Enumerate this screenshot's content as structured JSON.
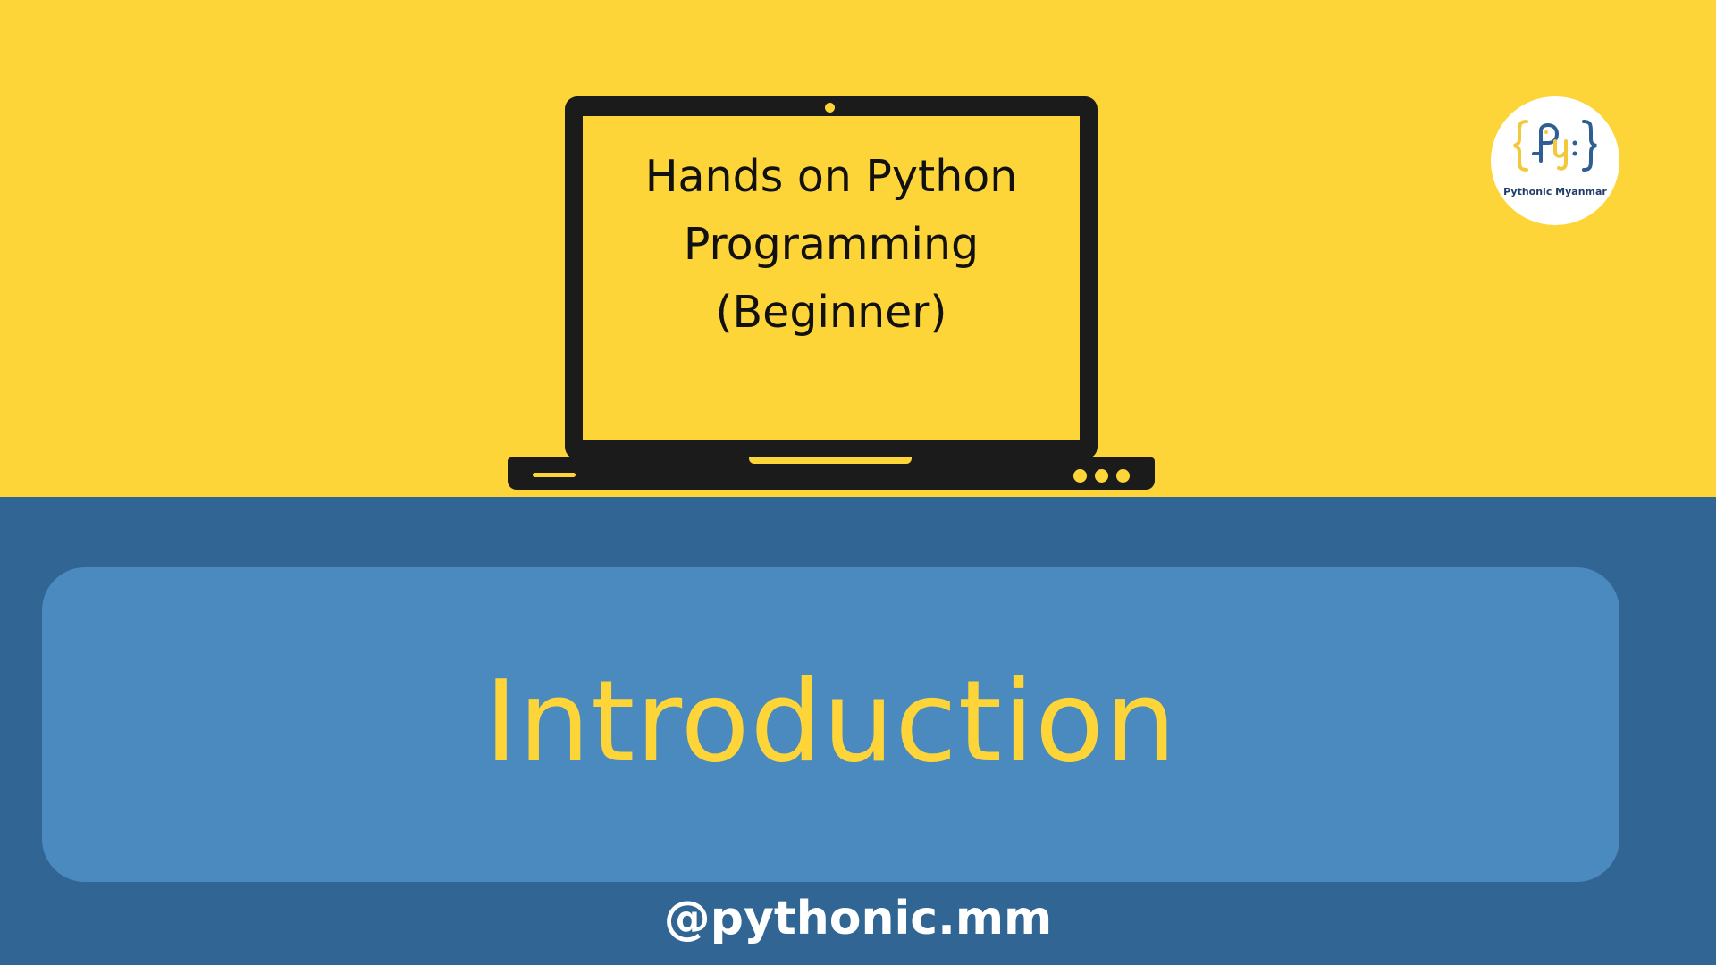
{
  "slide": {
    "title_lines": [
      "Hands on Python",
      "Programming",
      "(Beginner)"
    ],
    "heading": "Introduction",
    "handle": "@pythonic.mm"
  },
  "logo": {
    "caption": "Pythonic Myanmar",
    "icon": "pythonic-myanmar-logo"
  },
  "colors": {
    "yellow": "#FED539",
    "dark_blue": "#316694",
    "light_blue": "#4B8ABE",
    "laptop": "#1B1B1B",
    "logo_blue": "#2E5E93",
    "logo_yellow": "#F3C93B"
  }
}
